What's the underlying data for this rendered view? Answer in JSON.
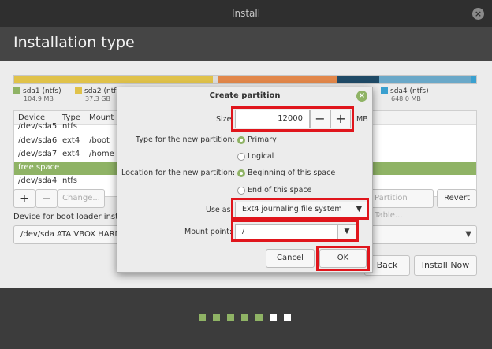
{
  "window": {
    "title": "Install",
    "close_glyph": "×"
  },
  "header": {
    "title": "Installation type"
  },
  "partition_bar": {
    "segments": [
      {
        "color": "#e0c24a"
      },
      {
        "color": "#dcdcdc"
      },
      {
        "color": "#e2874a"
      },
      {
        "color": "#1f4a66"
      },
      {
        "color": "#6aa8c8"
      },
      {
        "color": "#3aa0cf"
      }
    ]
  },
  "legend": [
    {
      "name": "sda1 (ntfs)",
      "size": "104.9 MB",
      "color": "#8fb365"
    },
    {
      "name": "sda2 (ntf",
      "size": "37.3 GB",
      "color": "#e0c24a"
    },
    {
      "name": "sda4 (ntfs)",
      "size": "648.0 MB",
      "color": "#3aa0cf"
    }
  ],
  "table": {
    "columns": [
      "Device",
      "Type",
      "Mount"
    ],
    "rows": [
      {
        "device": "/dev/sda5",
        "type": "ntfs",
        "mount": ""
      },
      {
        "device": "/dev/sda6",
        "type": "ext4",
        "mount": "/boot"
      },
      {
        "device": "/dev/sda7",
        "type": "ext4",
        "mount": "/home"
      },
      {
        "device": "free space",
        "type": "",
        "mount": ""
      },
      {
        "device": "/dev/sda4",
        "type": "ntfs",
        "mount": ""
      }
    ],
    "selected_index": 3
  },
  "table_buttons": {
    "add": "+",
    "remove": "−",
    "change": "Change...",
    "new_table": "Partition Table...",
    "revert": "Revert"
  },
  "bootloader": {
    "label": "Device for boot loader instal",
    "value": "/dev/sda   ATA VBOX HARD",
    "arrow": "▼"
  },
  "nav": {
    "back": "Back",
    "install": "Install Now"
  },
  "progress_dots": [
    {
      "color": "#8fb365"
    },
    {
      "color": "#8fb365"
    },
    {
      "color": "#8fb365"
    },
    {
      "color": "#8fb365"
    },
    {
      "color": "#8fb365"
    },
    {
      "color": "#ffffff"
    },
    {
      "color": "#ffffff"
    }
  ],
  "dialog": {
    "title": "Create partition",
    "close_glyph": "×",
    "size_label": "Size:",
    "size_value": "12000",
    "size_unit": "MB",
    "minus": "−",
    "plus": "+",
    "type_label": "Type for the new partition:",
    "type_primary": "Primary",
    "type_logical": "Logical",
    "location_label": "Location for the new partition:",
    "loc_begin": "Beginning of this space",
    "loc_end": "End of this space",
    "useas_label": "Use as:",
    "useas_value": "Ext4 journaling file system",
    "mount_label": "Mount point:",
    "mount_value": "/",
    "arrow": "▼",
    "cancel": "Cancel",
    "ok": "OK"
  }
}
